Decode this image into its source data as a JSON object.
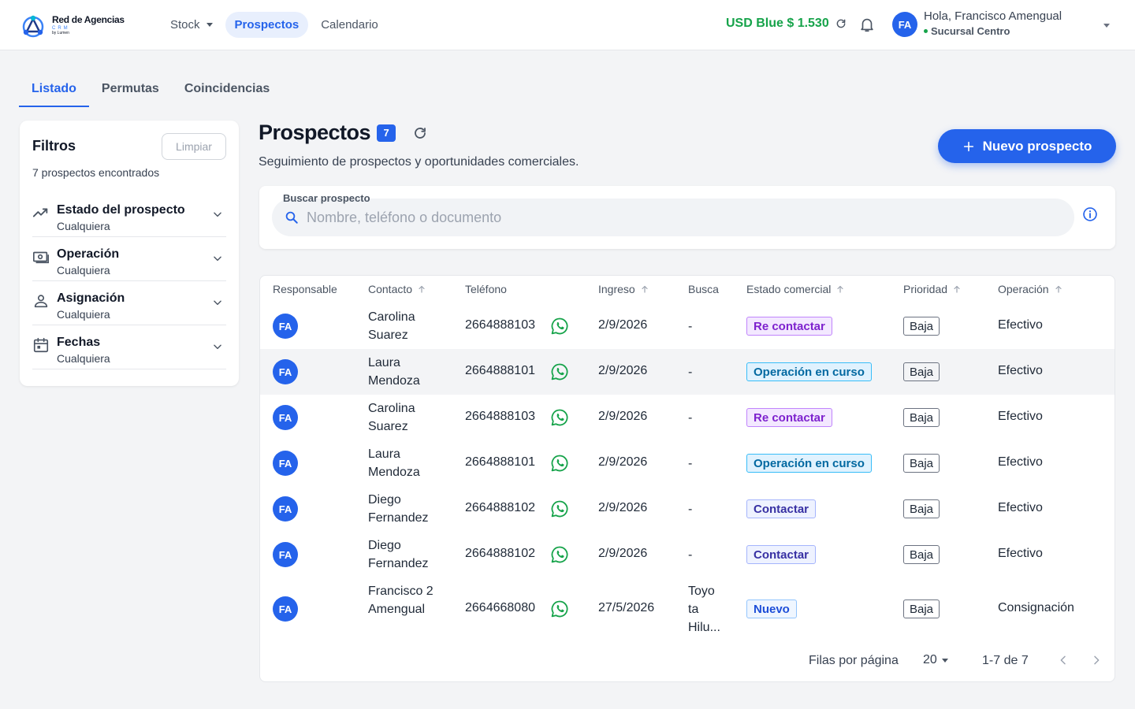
{
  "brand": {
    "name": "Red de Agencias",
    "sub": "CRM",
    "by": "by Lumen"
  },
  "nav": {
    "items": [
      {
        "label": "Stock"
      },
      {
        "label": "Prospectos"
      },
      {
        "label": "Calendario"
      }
    ]
  },
  "header": {
    "usd_label": "USD Blue $ 1.530",
    "avatar_initials": "FA",
    "greeting": "Hola, Francisco Amengual",
    "branch": "Sucursal Centro"
  },
  "tabs": [
    {
      "label": "Listado"
    },
    {
      "label": "Permutas"
    },
    {
      "label": "Coincidencias"
    }
  ],
  "filters": {
    "title": "Filtros",
    "clear_label": "Limpiar",
    "count_text": "7 prospectos encontrados",
    "items": [
      {
        "label": "Estado del prospecto",
        "value": "Cualquiera",
        "icon": "trending-icon"
      },
      {
        "label": "Operación",
        "value": "Cualquiera",
        "icon": "money-icon"
      },
      {
        "label": "Asignación",
        "value": "Cualquiera",
        "icon": "person-icon"
      },
      {
        "label": "Fechas",
        "value": "Cualquiera",
        "icon": "calendar-icon"
      }
    ]
  },
  "main": {
    "title": "Prospectos",
    "count": "7",
    "subtitle": "Seguimiento de prospectos y oportunidades comerciales.",
    "new_button": "Nuevo prospecto",
    "search": {
      "label": "Buscar prospecto",
      "placeholder": "Nombre, teléfono o documento"
    }
  },
  "table": {
    "columns": [
      "Responsable",
      "Contacto",
      "Teléfono",
      "Ingreso",
      "Busca",
      "Estado comercial",
      "Prioridad",
      "Operación"
    ],
    "rows": [
      {
        "initials": "FA",
        "contact": "Carolina Suarez",
        "phone": "2664888103",
        "ingreso": "2/9/2026",
        "busca": "-",
        "estado": "Re contactar",
        "prioridad": "Baja",
        "operacion": "Efectivo"
      },
      {
        "initials": "FA",
        "contact": "Laura Mendoza",
        "phone": "2664888101",
        "ingreso": "2/9/2026",
        "busca": "-",
        "estado": "Operación en curso",
        "prioridad": "Baja",
        "operacion": "Efectivo"
      },
      {
        "initials": "FA",
        "contact": "Carolina Suarez",
        "phone": "2664888103",
        "ingreso": "2/9/2026",
        "busca": "-",
        "estado": "Re contactar",
        "prioridad": "Baja",
        "operacion": "Efectivo"
      },
      {
        "initials": "FA",
        "contact": "Laura Mendoza",
        "phone": "2664888101",
        "ingreso": "2/9/2026",
        "busca": "-",
        "estado": "Operación en curso",
        "prioridad": "Baja",
        "operacion": "Efectivo"
      },
      {
        "initials": "FA",
        "contact": "Diego Fernandez",
        "phone": "2664888102",
        "ingreso": "2/9/2026",
        "busca": "-",
        "estado": "Contactar",
        "prioridad": "Baja",
        "operacion": "Efectivo"
      },
      {
        "initials": "FA",
        "contact": "Diego Fernandez",
        "phone": "2664888102",
        "ingreso": "2/9/2026",
        "busca": "-",
        "estado": "Contactar",
        "prioridad": "Baja",
        "operacion": "Efectivo"
      },
      {
        "initials": "FA",
        "contact": "Francisco 2 Amengual",
        "phone": "2664668080",
        "ingreso": "27/5/2026",
        "busca": "Toyo ta Hilu...",
        "estado": "Nuevo",
        "prioridad": "Baja",
        "operacion": "Consignación"
      }
    ]
  },
  "estado_colors": {
    "Re contactar": {
      "bg": "#f3e8ff",
      "border": "#c084fc",
      "text": "#7e22ce"
    },
    "Operación en curso": {
      "bg": "#e0f2fe",
      "border": "#38bdf8",
      "text": "#0369a1"
    },
    "Contactar": {
      "bg": "#eef2ff",
      "border": "#a5b4fc",
      "text": "#3730a3"
    },
    "Nuevo": {
      "bg": "#eff6ff",
      "border": "#93c5fd",
      "text": "#1d4ed8"
    }
  },
  "pagination": {
    "rows_label": "Filas por página",
    "rows_value": "20",
    "range": "1-7 de 7"
  },
  "colors": {
    "accent": "#2563eb",
    "usd": "#16a34a",
    "whatsapp": "#16a34a"
  }
}
